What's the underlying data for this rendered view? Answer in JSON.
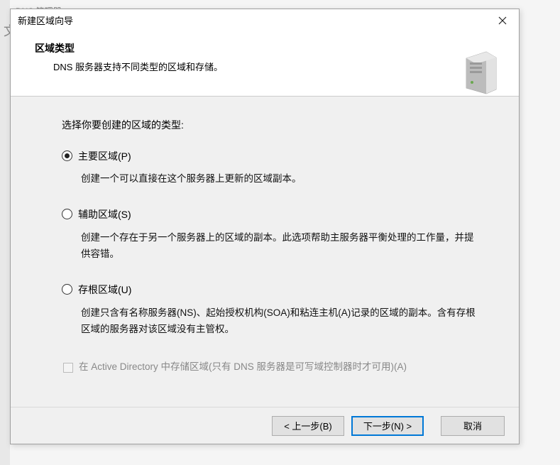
{
  "backdrop": {
    "tab": "DNS 管理器"
  },
  "dialog": {
    "title": "新建区域向导",
    "header": {
      "title": "区域类型",
      "subtitle": "DNS 服务器支持不同类型的区域和存储。"
    },
    "content": {
      "prompt": "选择你要创建的区域的类型:",
      "options": [
        {
          "value": "primary",
          "label": "主要区域(P)",
          "desc": "创建一个可以直接在这个服务器上更新的区域副本。",
          "selected": true
        },
        {
          "value": "secondary",
          "label": "辅助区域(S)",
          "desc": "创建一个存在于另一个服务器上的区域的副本。此选项帮助主服务器平衡处理的工作量，并提供容错。",
          "selected": false
        },
        {
          "value": "stub",
          "label": "存根区域(U)",
          "desc": "创建只含有名称服务器(NS)、起始授权机构(SOA)和粘连主机(A)记录的区域的副本。含有存根区域的服务器对该区域没有主管权。",
          "selected": false
        }
      ],
      "adCheckbox": {
        "label": "在 Active Directory 中存储区域(只有 DNS 服务器是可写域控制器时才可用)(A)",
        "enabled": false,
        "checked": false
      }
    },
    "footer": {
      "back": "< 上一步(B)",
      "next": "下一步(N) >",
      "cancel": "取消"
    }
  }
}
